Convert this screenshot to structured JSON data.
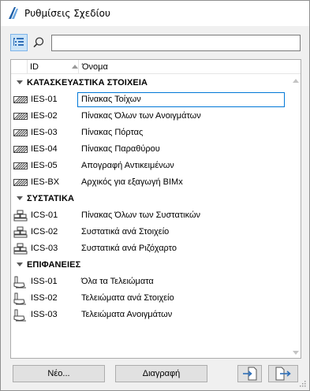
{
  "window": {
    "title": "Ρυθμίσεις Σχεδίου"
  },
  "toolbar": {
    "search_placeholder": "",
    "search_value": ""
  },
  "list": {
    "header": {
      "id": "ID",
      "name": "Όνομα"
    },
    "groups": [
      {
        "label": "ΚΑΤΑΣΚΕΥΑΣΤΙΚΑ ΣΤΟΙΧΕΙΑ",
        "icon": "hatch-schedule-icon",
        "items": [
          {
            "id": "IES-01",
            "name": "Πίνακας Τοίχων",
            "selected": true
          },
          {
            "id": "IES-02",
            "name": "Πίνακας Όλων των Ανοιγμάτων"
          },
          {
            "id": "IES-03",
            "name": "Πίνακας Πόρτας"
          },
          {
            "id": "IES-04",
            "name": "Πίνακας Παραθύρου"
          },
          {
            "id": "IES-05",
            "name": "Απογραφή Αντικειμένων"
          },
          {
            "id": "IES-BX",
            "name": "Αρχικός για εξαγωγή BIMx"
          }
        ]
      },
      {
        "label": "ΣΥΣΤΑΤΙΚΑ",
        "icon": "components-schedule-icon",
        "items": [
          {
            "id": "ICS-01",
            "name": "Πίνακας Όλων των Συστατικών"
          },
          {
            "id": "ICS-02",
            "name": "Συστατικά ανά Στοιχείο"
          },
          {
            "id": "ICS-03",
            "name": "Συστατικά ανά Ριζόχαρτο"
          }
        ]
      },
      {
        "label": "ΕΠΙΦΑΝΕΙΕΣ",
        "icon": "paint-brush-icon",
        "items": [
          {
            "id": "ISS-01",
            "name": "Όλα τα Τελειώματα"
          },
          {
            "id": "ISS-02",
            "name": "Τελειώματα ανά Στοιχείο"
          },
          {
            "id": "ISS-03",
            "name": "Τελειώματα Ανοιγμάτων"
          }
        ]
      }
    ]
  },
  "buttons": {
    "new": "Νέο...",
    "delete": "Διαγραφή"
  },
  "colors": {
    "selection": "#0078d7",
    "toggle_bg": "#cce4f7",
    "toggle_border": "#7eb4ea",
    "icon_blue": "#2f6fb8"
  }
}
